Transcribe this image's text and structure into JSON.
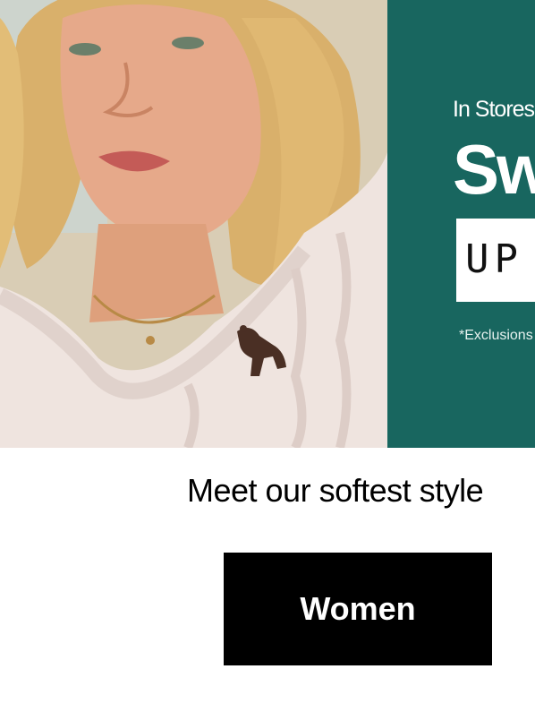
{
  "hero": {
    "promo": {
      "eyebrow": "In Stores",
      "headline": "Sw",
      "offer": "UP",
      "fine_print": "*Exclusions"
    }
  },
  "tagline": "Meet our softest style",
  "cta": {
    "label": "Women"
  },
  "colors": {
    "promo_bg": "#18665f",
    "cta_bg": "#000000"
  }
}
